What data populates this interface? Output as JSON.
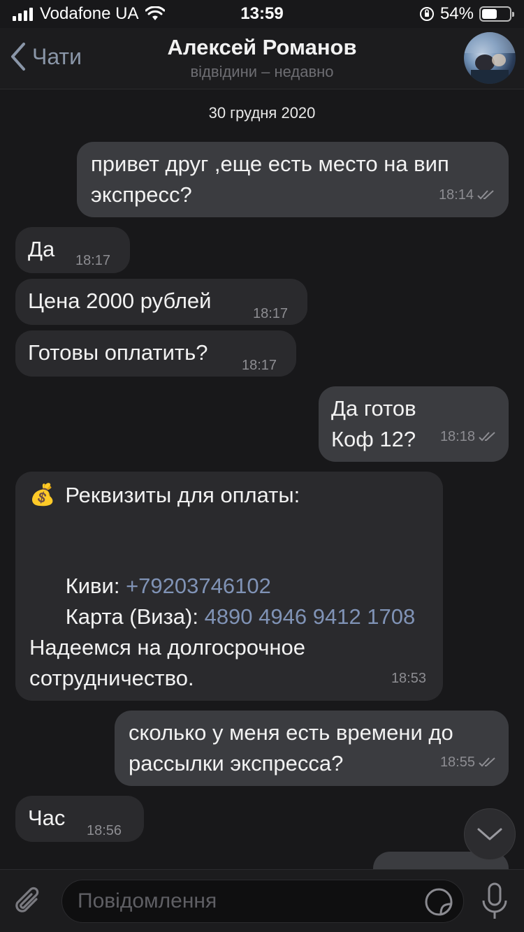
{
  "status_bar": {
    "carrier": "Vodafone UA",
    "time": "13:59",
    "battery": "54%",
    "battery_level": 0.54
  },
  "header": {
    "back_label": "Чати",
    "title": "Алексей Романов",
    "subtitle": "відвідини – недавно"
  },
  "chat": {
    "date": "30 грудня 2020",
    "messages": [
      {
        "dir": "out",
        "text": "привет друг ,еще есть место на вип\nэкспресс?",
        "time": "18:14",
        "read": true
      },
      {
        "dir": "in",
        "text": "Да",
        "time": "18:17"
      },
      {
        "dir": "in",
        "text": "Цена 2000 рублей",
        "time": "18:17"
      },
      {
        "dir": "in",
        "text": "Готовы оплатить?",
        "time": "18:17"
      },
      {
        "dir": "out",
        "text": "Да готов\nКоф 12?",
        "time": "18:18",
        "read": true
      },
      {
        "dir": "in",
        "emoji": "💰",
        "heading": "Реквизиты для оплаты:",
        "qiwi_label": "Киви: ",
        "qiwi_value": "+79203746102",
        "card_label": "Карта (Виза): ",
        "card_value": "4890 4946 9412 1708",
        "closing": "Надеемся на долгосрочное\nсотрудничество.",
        "time": "18:53"
      },
      {
        "dir": "out",
        "text": "сколько у меня есть времени до\nрассылки экспресса?",
        "time": "18:55",
        "read": true
      },
      {
        "dir": "in",
        "text": "Час",
        "time": "18:56"
      }
    ]
  },
  "input": {
    "placeholder": "Повідомлення"
  },
  "icons": {
    "back": "chevron-left-icon",
    "attach": "paperclip-icon",
    "sticker": "sticker-icon",
    "mic": "microphone-icon",
    "scroll": "chevron-down-icon"
  },
  "colors": {
    "background": "#18181a",
    "bubble_out": "#3b3c40",
    "bubble_in": "#2a2a2d",
    "link": "#8093b6",
    "accent": "#8a96a8"
  }
}
